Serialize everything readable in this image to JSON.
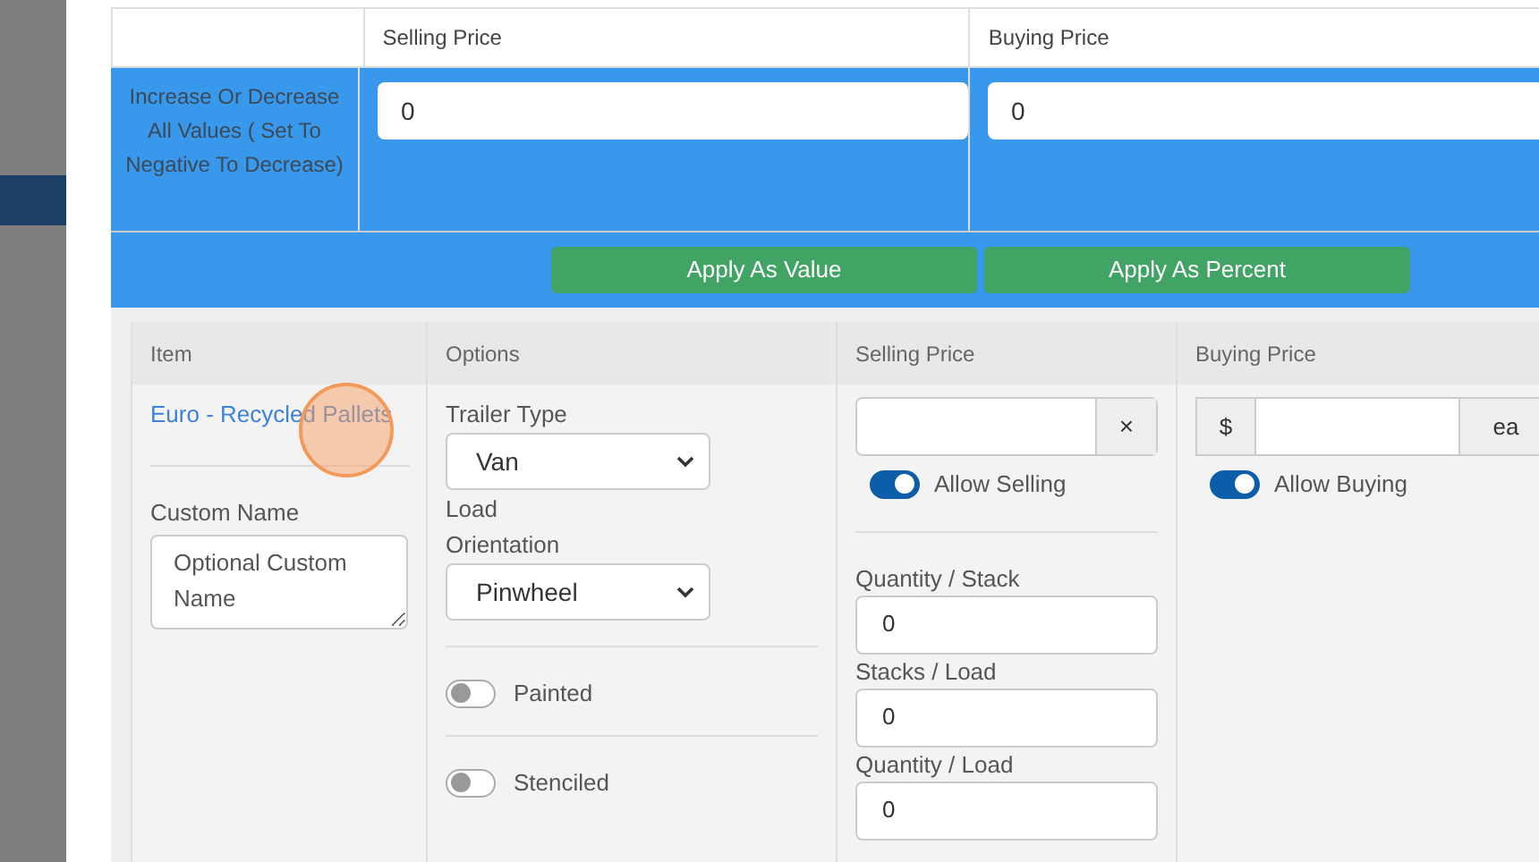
{
  "adjust_table": {
    "columns": [
      "Selling Price",
      "Buying Price"
    ],
    "row_label": "Increase Or Decrease All Values ( Set To Negative To Decrease)",
    "values": [
      "0",
      "0"
    ],
    "buttons": [
      "Apply As Value",
      "Apply As Percent"
    ]
  },
  "item_table": {
    "columns": [
      "Item",
      "Options",
      "Selling Price",
      "Buying Price"
    ],
    "item": {
      "name": "Euro - Recycled Pallets",
      "custom_name_label": "Custom Name",
      "custom_name_placeholder": "Optional Custom Name"
    },
    "selects": [
      {
        "label": "Trailer Type",
        "value": "Van"
      },
      {
        "label": "Load Orientation",
        "value": "Pinwheel"
      }
    ],
    "toggles": [
      {
        "label": "Painted",
        "on": false
      },
      {
        "label": "Stenciled",
        "on": false
      }
    ],
    "selling": {
      "clear": "×",
      "toggle": {
        "label": "Allow Selling",
        "on": true
      },
      "fields": [
        {
          "label": "Quantity / Stack",
          "value": "0"
        },
        {
          "label": "Stacks / Load",
          "value": "0"
        },
        {
          "label": "Quantity / Load",
          "value": "0"
        }
      ]
    },
    "buying": {
      "prefix": "$",
      "suffix": "ea",
      "toggle": {
        "label": "Allow Buying",
        "on": true
      }
    }
  }
}
